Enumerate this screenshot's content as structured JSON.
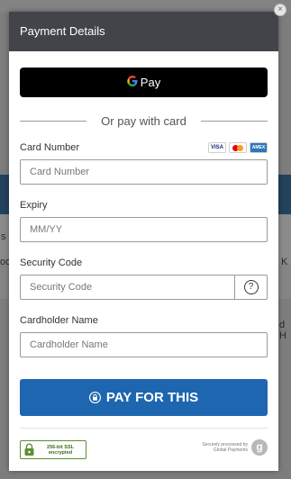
{
  "modal": {
    "title": "Payment Details",
    "close_label": "×",
    "gpay_label": "Pay",
    "gpay_g": "G",
    "divider_text": "Or pay with card",
    "card_number": {
      "label": "Card Number",
      "placeholder": "Card Number"
    },
    "card_logos": [
      "VISA",
      "mastercard",
      "AMEX"
    ],
    "expiry": {
      "label": "Expiry",
      "placeholder": "MM/YY"
    },
    "security_code": {
      "label": "Security Code",
      "placeholder": "Security Code",
      "help": "?"
    },
    "cardholder": {
      "label": "Cardholder Name",
      "placeholder": "Cardholder Name"
    },
    "pay_button": "PAY FOR THIS",
    "ssl_badge": {
      "line1": "256-bit SSL",
      "line2": "encrypted"
    },
    "processor": {
      "line1": "Securely processed by",
      "line2": "Global Payments",
      "logo": "g"
    }
  },
  "background": {
    "edge_texts": [
      "s",
      "oo",
      "K",
      "d H"
    ]
  },
  "colors": {
    "header": "#424449",
    "pay_button": "#1e66b0",
    "ssl_green": "#5b8f32"
  }
}
